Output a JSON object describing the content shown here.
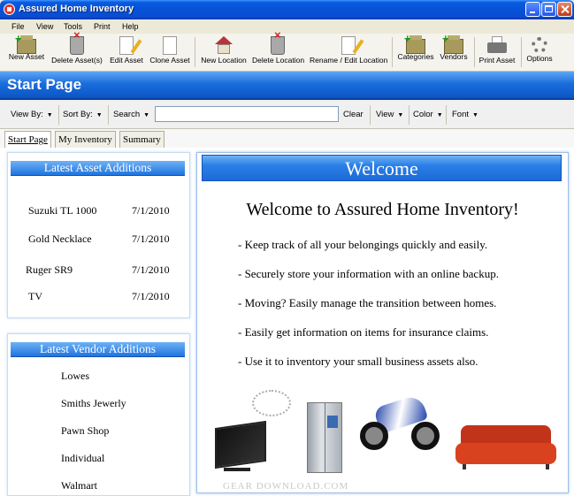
{
  "window": {
    "title": "Assured Home Inventory"
  },
  "menu": [
    "File",
    "View",
    "Tools",
    "Print",
    "Help"
  ],
  "toolbar": {
    "new_asset": "New Asset",
    "delete_assets": "Delete Asset(s)",
    "edit_asset": "Edit Asset",
    "clone_asset": "Clone Asset",
    "new_location": "New Location",
    "delete_location": "Delete Location",
    "rename_location": "Rename / Edit Location",
    "categories": "Categories",
    "vendors": "Vendors",
    "print_asset": "Print Asset",
    "options": "Options"
  },
  "banner": {
    "title": "Start Page"
  },
  "filterbar": {
    "view_by": "View By:",
    "sort_by": "Sort By:",
    "search": "Search",
    "search_value": "",
    "clear": "Clear",
    "view": "View",
    "color": "Color",
    "font": "Font"
  },
  "tabs": [
    "Start Page",
    "My Inventory",
    "Summary"
  ],
  "latest_assets": {
    "title": "Latest Asset Additions",
    "items": [
      {
        "name": "Suzuki TL 1000",
        "date": "7/1/2010"
      },
      {
        "name": "Gold Necklace",
        "date": "7/1/2010"
      },
      {
        "name": "Ruger SR9",
        "date": "7/1/2010"
      },
      {
        "name": "TV",
        "date": "7/1/2010"
      }
    ]
  },
  "latest_vendors": {
    "title": "Latest Vendor Additions",
    "items": [
      "Lowes",
      "Smiths Jewerly",
      "Pawn Shop",
      "Individual",
      "Walmart"
    ]
  },
  "welcome": {
    "header": "Welcome",
    "heading": "Welcome to Assured Home Inventory!",
    "bullets": [
      "- Keep track of all your belongings quickly and easily.",
      "- Securely store your information with an online backup.",
      "- Moving?  Easily manage the transition between homes.",
      "- Easily get information on items for insurance claims.",
      "- Use it to inventory your small business assets also."
    ]
  },
  "watermark": "GEAR DOWNLOAD.COM"
}
